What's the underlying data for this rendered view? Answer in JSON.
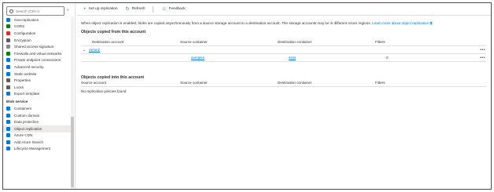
{
  "sidebar": {
    "search_placeholder": "Search (Ctrl+/)",
    "collapse_glyph": "«",
    "items_top": [
      {
        "label": "Geo-replication",
        "icon": "globe-icon",
        "color": "#0078d4"
      },
      {
        "label": "CORS",
        "icon": "cors-icon",
        "color": "#107c10"
      },
      {
        "label": "Configuration",
        "icon": "configuration-icon",
        "color": "#d13438"
      },
      {
        "label": "Encryption",
        "icon": "lock-icon",
        "color": "#605e5c"
      },
      {
        "label": "Shared access signature",
        "icon": "link-icon",
        "color": "#8a8886"
      },
      {
        "label": "Firewalls and virtual networks",
        "icon": "firewall-icon",
        "color": "#107c10"
      },
      {
        "label": "Private endpoint connections",
        "icon": "endpoint-icon",
        "color": "#0078d4"
      },
      {
        "label": "Advanced security",
        "icon": "shield-icon",
        "color": "#0078d4"
      },
      {
        "label": "Static website",
        "icon": "website-icon",
        "color": "#0078d4"
      },
      {
        "label": "Properties",
        "icon": "properties-icon",
        "color": "#605e5c"
      },
      {
        "label": "Locks",
        "icon": "lock-icon",
        "color": "#605e5c"
      },
      {
        "label": "Export template",
        "icon": "export-icon",
        "color": "#0078d4"
      }
    ],
    "section_label": "Blob service",
    "items_blob": [
      {
        "label": "Containers",
        "icon": "containers-icon",
        "color": "#0078d4"
      },
      {
        "label": "Custom domain",
        "icon": "domain-icon",
        "color": "#0078d4"
      },
      {
        "label": "Data protection",
        "icon": "shield-icon",
        "color": "#0078d4"
      },
      {
        "label": "Object replication",
        "icon": "replication-icon",
        "color": "#0078d4",
        "selected": true
      },
      {
        "label": "Azure CDN",
        "icon": "cdn-icon",
        "color": "#0078d4"
      },
      {
        "label": "Add Azure Search",
        "icon": "cloud-search-icon",
        "color": "#0078d4"
      },
      {
        "label": "Lifecycle Management",
        "icon": "lifecycle-icon",
        "color": "#0078d4"
      }
    ]
  },
  "toolbar": {
    "setup_label": "Set up replication",
    "refresh_label": "Refresh",
    "feedback_label": "Feedback"
  },
  "info": {
    "text": "When object replication is enabled, blobs are copied asynchronously from a source storage account to a destination account. The storage accounts may be in different Azure regions.",
    "link": "Learn more about object replication"
  },
  "outgoing": {
    "title": "Objects copied from this account",
    "headers": [
      "Destination account",
      "Source container",
      "Destination container",
      "Filters"
    ],
    "group_account": "ranoriz",
    "row": {
      "source": "samples",
      "destination": "ssss",
      "filters": "0"
    }
  },
  "incoming": {
    "title": "Objects copied into this account",
    "headers": [
      "Source account",
      "Source container",
      "Destination container",
      "Filters"
    ],
    "empty": "No replication policies found"
  },
  "more_glyph": "•••"
}
